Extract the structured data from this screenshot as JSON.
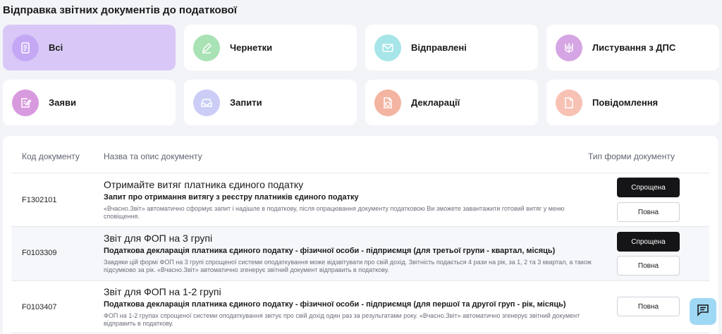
{
  "page": {
    "title": "Відправка звітних документів до податкової"
  },
  "categories": [
    {
      "label": "Всі",
      "icon": "document-list-icon",
      "color": "#c5a8f5",
      "active": true
    },
    {
      "label": "Чернетки",
      "icon": "pencil-icon",
      "color": "#a9e2b4",
      "active": false
    },
    {
      "label": "Відправлені",
      "icon": "envelope-icon",
      "color": "#a6e5e8",
      "active": false
    },
    {
      "label": "Листування з ДПС",
      "icon": "trident-icon",
      "color": "#d6a5e3",
      "active": false
    },
    {
      "label": "Заяви",
      "icon": "edit-document-icon",
      "color": "#d89ade",
      "active": false
    },
    {
      "label": "Запити",
      "icon": "inbox-icon",
      "color": "#cbcdf6",
      "active": false
    },
    {
      "label": "Декларації",
      "icon": "shield-document-icon",
      "color": "#f3b4a1",
      "active": false
    },
    {
      "label": "Повідомлення",
      "icon": "file-icon",
      "color": "#f7c2b4",
      "active": false
    }
  ],
  "table": {
    "headers": {
      "code": "Код документу",
      "name": "Назва та опис документу",
      "type": "Тип форми документу"
    },
    "rows": [
      {
        "code": "F1302101",
        "title": "Отримайте витяг платника єдиного податку",
        "subtitle": "Запит про отримання витягу з реєстру платників єдиного податку",
        "description": "«Вчасно.Звіт» автоматично сформує запит і надішле в податкову, після опрацювання документу податковою Ви зможете завантажити готовий витяг у меню сповіщення.",
        "buttons": [
          "Спрощена",
          "Повна"
        ]
      },
      {
        "code": "F0103309",
        "title": "Звіт для ФОП на 3 групі",
        "subtitle": "Податкова декларація платника єдиного податку - фізичної особи - підприємця (для третьої групи - квартал, місяць)",
        "description": "Завдяки цій формі ФОП на 3 групі спрощеної системи оподаткування може відзвітувати про свій дохід. Звітність подається 4 рази на рік, за 1, 2 та 3 квартал, а також підсумково за рік. «Вчасно.Звіт» автоматично згенерує звітний документ відправить в податкову.",
        "buttons": [
          "Спрощена",
          "Повна"
        ]
      },
      {
        "code": "F0103407",
        "title": "Звіт для ФОП на 1-2 групі",
        "subtitle": "Податкова декларація платника єдиного податку - фізичної особи - підприємця (для першої та другої груп - рік, місяць)",
        "description": "ФОП на 1-2 групах спрощеної системи оподаткування звітує про свій дохід один раз за результатами року. «Вчасно.Звіт» автоматично згенерує звітний документ відправить в податкову.",
        "buttons": [
          "Повна"
        ]
      }
    ]
  },
  "chat": {
    "icon": "chat-icon",
    "color": "#9fd8f5"
  }
}
